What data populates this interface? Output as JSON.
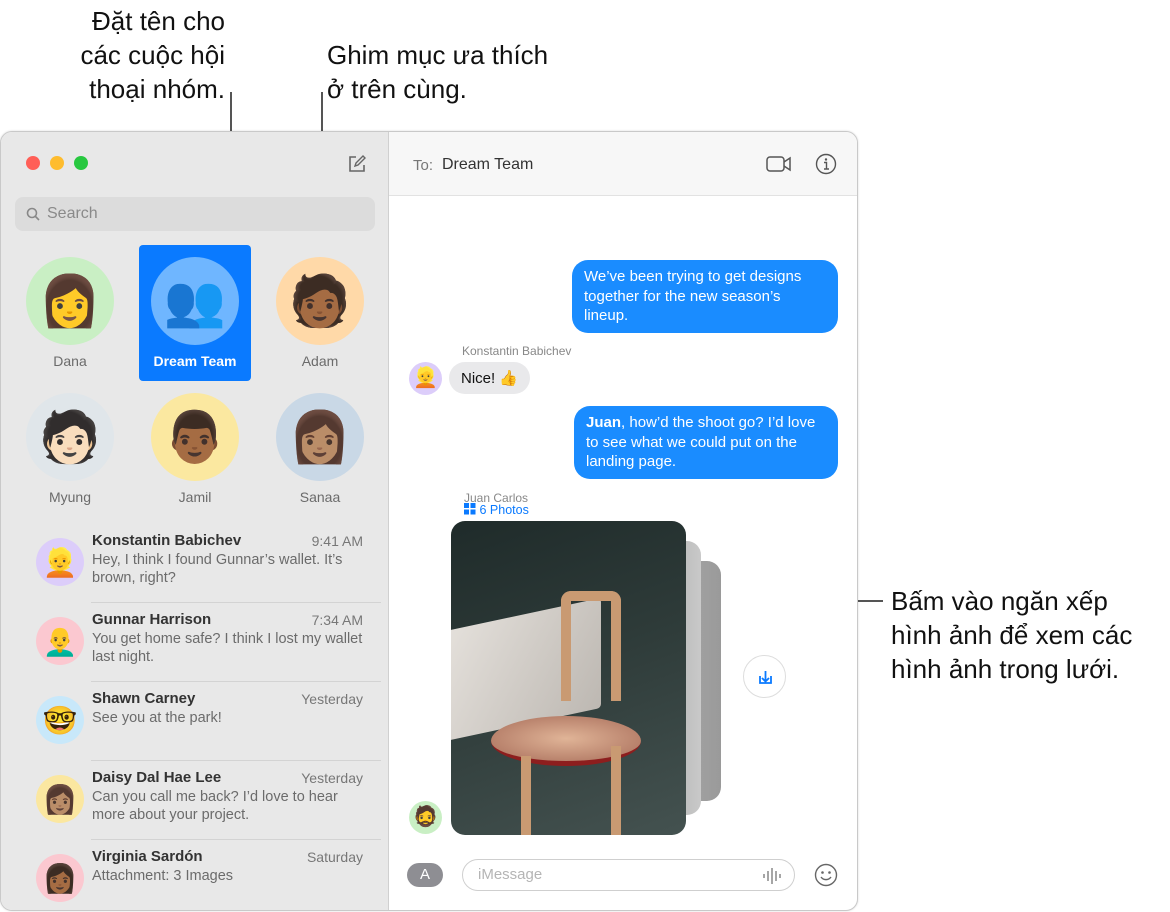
{
  "callouts": {
    "group_name": [
      "Đặt tên cho",
      "các cuộc hội",
      "thoại nhóm."
    ],
    "pin": [
      "Ghim mục ưa thích",
      "ở trên cùng."
    ],
    "stack": [
      "Bấm vào ngăn xếp",
      "hình ảnh để xem các",
      "hình ảnh trong lưới."
    ]
  },
  "sidebar": {
    "search_placeholder": "Search",
    "pinned": [
      {
        "name": "Dana",
        "emoji": "👩",
        "bg": "#c9efc4"
      },
      {
        "name": "Dream Team",
        "emoji": "👥",
        "bg": "#6fb6ff",
        "selected": true
      },
      {
        "name": "Adam",
        "emoji": "🧑🏾",
        "bg": "#ffd9a8"
      },
      {
        "name": "Myung",
        "emoji": "🧑🏻",
        "bg": "#e0e6ea"
      },
      {
        "name": "Jamil",
        "emoji": "👨🏾",
        "bg": "#fbe8a0"
      },
      {
        "name": "Sanaa",
        "emoji": "👩🏽",
        "bg": "#c9d8e6"
      }
    ],
    "conversations": [
      {
        "name": "Konstantin Babichev",
        "time": "9:41 AM",
        "preview": "Hey, I think I found Gunnar’s wallet. It’s brown, right?",
        "emoji": "👱",
        "bg": "#dccdfa"
      },
      {
        "name": "Gunnar Harrison",
        "time": "7:34 AM",
        "preview": "You get home safe? I think I lost my wallet last night.",
        "emoji": "👨‍🦲",
        "bg": "#fbc8d0"
      },
      {
        "name": "Shawn Carney",
        "time": "Yesterday",
        "preview": "See you at the park!",
        "emoji": "🤓",
        "bg": "#c8e8fa"
      },
      {
        "name": "Daisy Dal Hae Lee",
        "time": "Yesterday",
        "preview": "Can you call me back? I’d love to hear more about your project.",
        "emoji": "👩🏽",
        "bg": "#fbe7a0"
      },
      {
        "name": "Virginia Sardón",
        "time": "Saturday",
        "preview": "Attachment: 3 Images",
        "emoji": "👩🏾",
        "bg": "#fbc8d0"
      }
    ]
  },
  "chat": {
    "to_label": "To:",
    "recipient": "Dream Team",
    "messages": [
      {
        "from": "me",
        "text": "We’ve been trying to get designs together for the new season’s lineup."
      },
      {
        "from": "Konstantin Babichev",
        "text": "Nice! 👍"
      },
      {
        "from": "me",
        "bold": "Juan",
        "text": ", how’d the shoot go? I’d love to see what we could put on the landing page."
      }
    ],
    "photo_sender": "Juan Carlos",
    "photo_count_label": "6 Photos",
    "input_placeholder": "iMessage"
  },
  "colors": {
    "accent": "#0a7aff",
    "bubble_me": "#1a8cff",
    "bubble_them": "#e9e9eb"
  }
}
